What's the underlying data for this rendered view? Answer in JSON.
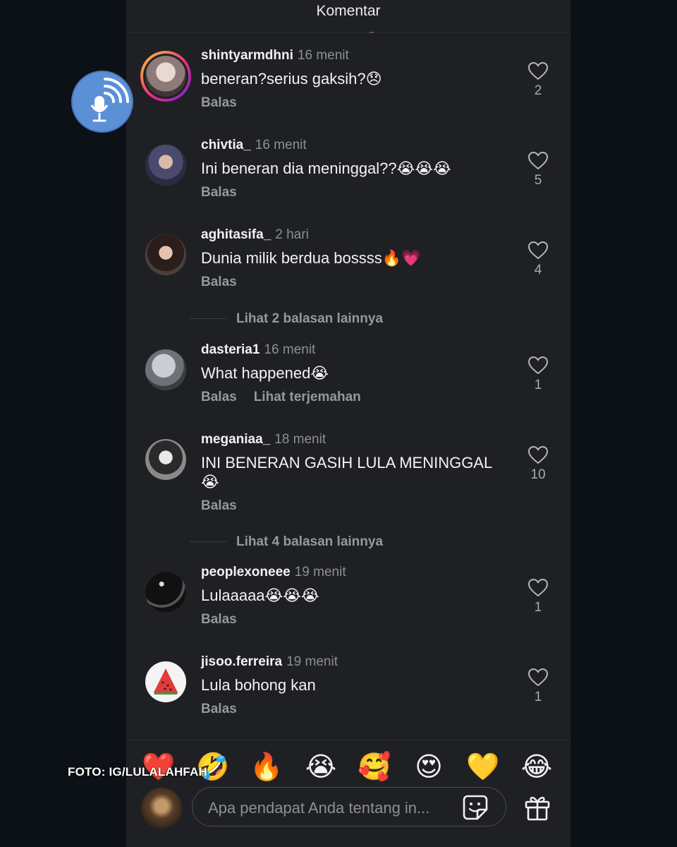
{
  "header": {
    "title": "Komentar"
  },
  "comments": [
    {
      "user": "shintyarmdhni",
      "time": "16 menit",
      "text": "beneran?serius gaksih?😞",
      "reply": "Balas",
      "extra": "",
      "likes": "2"
    },
    {
      "user": "chivtia_",
      "time": "16 menit",
      "text": "Ini beneran dia meninggal??😭😭😭",
      "reply": "Balas",
      "extra": "",
      "likes": "5"
    },
    {
      "user": "aghitasifa_",
      "time": "2 hari",
      "text": "Dunia milik berdua bossss🔥💗",
      "reply": "Balas",
      "extra": "",
      "likes": "4"
    },
    {
      "user": "dasteria1",
      "time": "16 menit",
      "text": "What happened😭",
      "reply": "Balas",
      "extra": "Lihat terjemahan",
      "likes": "1"
    },
    {
      "user": "meganiaa_",
      "time": "18 menit",
      "text": "INI BENERAN GASIH LULA MENINGGAL 😭",
      "reply": "Balas",
      "extra": "",
      "likes": "10"
    },
    {
      "user": "peoplexoneee",
      "time": "19 menit",
      "text": "Lulaaaaa😭😭😭",
      "reply": "Balas",
      "extra": "",
      "likes": "1"
    },
    {
      "user": "jisoo.ferreira",
      "time": "19 menit",
      "text": "Lula bohong kan",
      "reply": "Balas",
      "extra": "",
      "likes": "1"
    }
  ],
  "more_replies": [
    {
      "label": "Lihat 2 balasan lainnya"
    },
    {
      "label": "Lihat 4 balasan lainnya"
    }
  ],
  "emoji_bar": [
    "❤️",
    "🤣",
    "🔥",
    "😭",
    "🥰",
    "😍",
    "💛",
    "😂"
  ],
  "composer": {
    "placeholder": "Apa pendapat Anda tentang in..."
  },
  "watermark": "FOTO: IG/LULALAHFAH",
  "icons": {
    "like": "heart-outline-icon",
    "sticker": "sticker-icon",
    "gift": "gift-icon",
    "podcast": "podcast-mic-icon"
  },
  "colors": {
    "background": "#0c1117",
    "panel": "#1f2024",
    "muted_text": "#8d8f96",
    "podcast_badge": "#5b8fd6"
  }
}
